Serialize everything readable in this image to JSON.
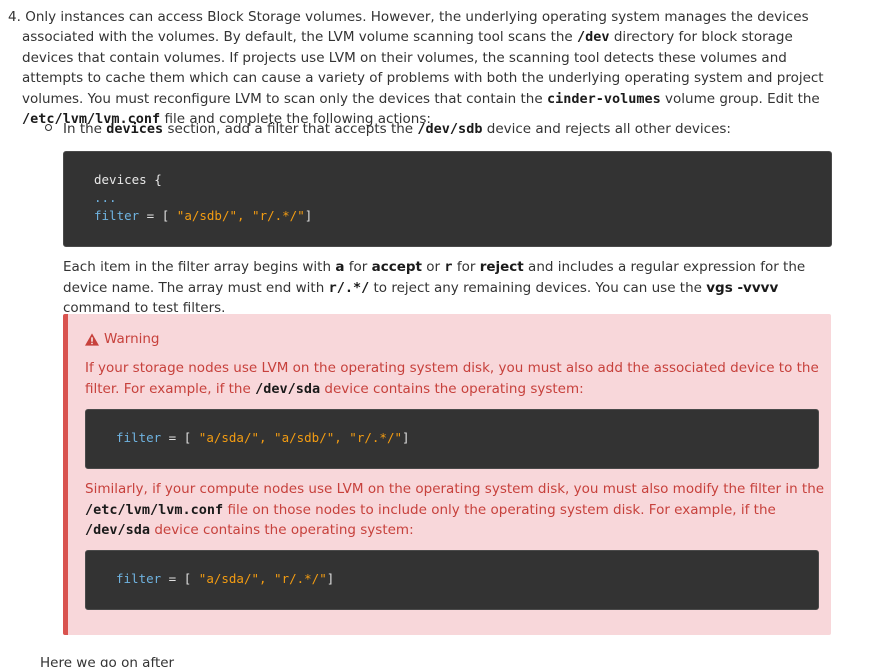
{
  "step": {
    "number": "4.",
    "t1": "Only instances can access Block Storage volumes. However, the underlying operating system manages the devices associated with the volumes. By default, the LVM volume scanning tool scans the ",
    "dev": "/dev",
    "t2": " directory for block storage devices that contain volumes. If projects use LVM on their volumes, the scanning tool detects these volumes and attempts to cache them which can cause a variety of problems with both the underlying operating system and project volumes. You must reconfigure LVM to scan only the devices that contain the ",
    "cinder": "cinder-volumes",
    "t3": " volume group. Edit the ",
    "lvmconf": "/etc/lvm/lvm.conf",
    "t4": " file and complete the following actions:"
  },
  "sub": {
    "t1": "In the ",
    "devices": "devices",
    "t2": " section, add a filter that accepts the ",
    "sdb": "/dev/sdb",
    "t3": " device and rejects all other devices:"
  },
  "code1": {
    "line1": "devices {",
    "line2": "...",
    "key": "filter",
    "eq": " = [ ",
    "vals": "\"a/sdb/\", \"r/.*/\"",
    "close": "]"
  },
  "para": {
    "t1": "Each item in the filter array begins with ",
    "a": "a",
    "t2": " for ",
    "accept": "accept",
    "t3": " or ",
    "r": "r",
    "t4": " for ",
    "reject": "reject",
    "t5": " and includes a regular expression for the device name. The array must end with ",
    "rall": "r/.*/",
    "t6": " to reject any remaining devices. You can use the ",
    "vgs": "vgs -vvvv",
    "t7": " command to test filters."
  },
  "warning": {
    "title": "Warning",
    "p1_t1": "If your storage nodes use LVM on the operating system disk, you must also add the associated device to the filter. For example, if the ",
    "p1_sda": "/dev/sda",
    "p1_t2": " device contains the operating system:",
    "code2": {
      "key": "filter",
      "eq": " = [ ",
      "vals": "\"a/sda/\", \"a/sdb/\", \"r/.*/\"",
      "close": "]"
    },
    "p2_t1": "Similarly, if your compute nodes use LVM on the operating system disk, you must also modify the filter in the ",
    "p2_conf": "/etc/lvm/lvm.conf",
    "p2_t2": " file on those nodes to include only the operating system disk. For example, if the ",
    "p2_sda": "/dev/sda",
    "p2_t3": " device contains the operating system:",
    "code3": {
      "key": "filter",
      "eq": " = [ ",
      "vals": "\"a/sda/\", \"r/.*/\"",
      "close": "]"
    }
  },
  "next_step_partial": "Here we go on after",
  "colors": {
    "warning_bg": "#f8d7da",
    "warning_text": "#c7413c",
    "code_bg": "#333333",
    "code_attr": "#6fb3e0",
    "code_string": "#f39c12"
  }
}
